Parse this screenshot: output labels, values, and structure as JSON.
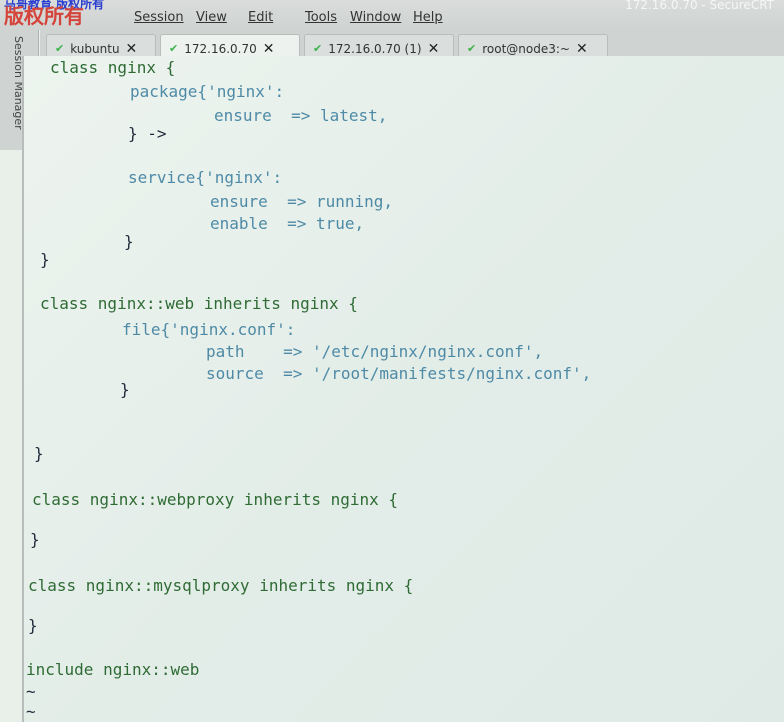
{
  "app": {
    "watermark_line1": "马哥教育 版权所有",
    "watermark_line2": "版权所有",
    "window_title": "172.16.0.70 - SecureCRT"
  },
  "menus": [
    "Session",
    "View",
    "Edit",
    "Tools",
    "Window",
    "Help"
  ],
  "tabs": [
    {
      "label": "kubuntu"
    },
    {
      "label": "172.16.0.70"
    },
    {
      "label": "172.16.0.70 (1)"
    },
    {
      "label": "root@node3:~"
    }
  ],
  "sidebar": {
    "label": "Session Manager"
  },
  "terminal": {
    "lines": [
      "class nginx {",
      "package{'nginx':",
      "ensure  => latest,",
      "} ->",
      "service{'nginx':",
      "ensure  => running,",
      "enable  => true,",
      "}",
      "}",
      "class nginx::web inherits nginx {",
      "file{'nginx.conf':",
      "path    => '/etc/nginx/nginx.conf',",
      "source  => '/root/manifests/nginx.conf',",
      "}",
      "}",
      "class nginx::webproxy inherits nginx {",
      "}",
      "class nginx::mysqlproxy inherits nginx {",
      "}",
      "include nginx::web",
      "~",
      "~"
    ]
  }
}
